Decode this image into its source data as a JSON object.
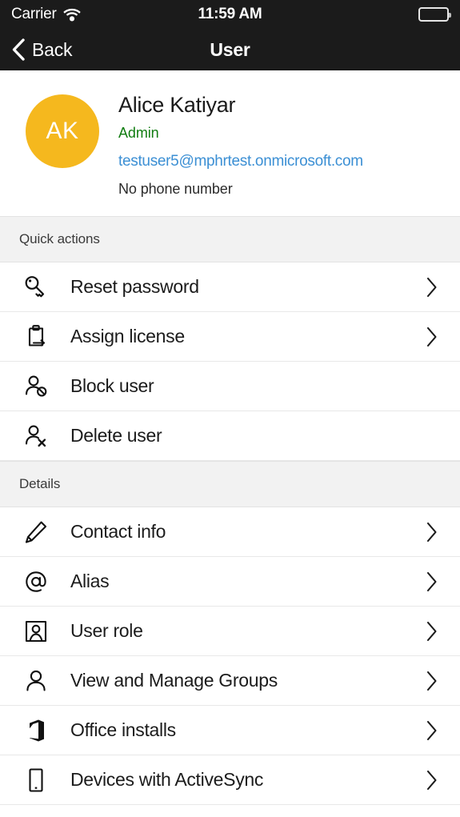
{
  "status_bar": {
    "carrier": "Carrier",
    "wifi_icon": "wifi-icon",
    "time": "11:59 AM",
    "battery_icon": "battery-full-icon"
  },
  "nav_bar": {
    "back_icon": "chevron-left-icon",
    "back_label": "Back",
    "title": "User"
  },
  "profile": {
    "avatar_initials": "AK",
    "avatar_color": "#F5B81E",
    "name": "Alice Katiyar",
    "role": "Admin",
    "role_color": "#107C10",
    "email": "testuser5@mphrtest.onmicrosoft.com",
    "email_color": "#3B8FD4",
    "phone": "No phone number"
  },
  "sections": [
    {
      "header": "Quick actions",
      "rows": [
        {
          "label": "Reset password",
          "icon": "key-icon",
          "chevron": true
        },
        {
          "label": "Assign license",
          "icon": "assign-license-icon",
          "chevron": true
        },
        {
          "label": "Block user",
          "icon": "block-user-icon",
          "chevron": false
        },
        {
          "label": "Delete user",
          "icon": "delete-user-icon",
          "chevron": false
        }
      ]
    },
    {
      "header": "Details",
      "rows": [
        {
          "label": "Contact info",
          "icon": "pencil-icon",
          "chevron": true
        },
        {
          "label": "Alias",
          "icon": "at-sign-icon",
          "chevron": true
        },
        {
          "label": "User role",
          "icon": "user-badge-icon",
          "chevron": true
        },
        {
          "label": "View and Manage Groups",
          "icon": "person-icon",
          "chevron": true
        },
        {
          "label": "Office installs",
          "icon": "office-logo-icon",
          "chevron": true
        },
        {
          "label": "Devices with ActiveSync",
          "icon": "phone-icon",
          "chevron": true
        }
      ]
    }
  ]
}
